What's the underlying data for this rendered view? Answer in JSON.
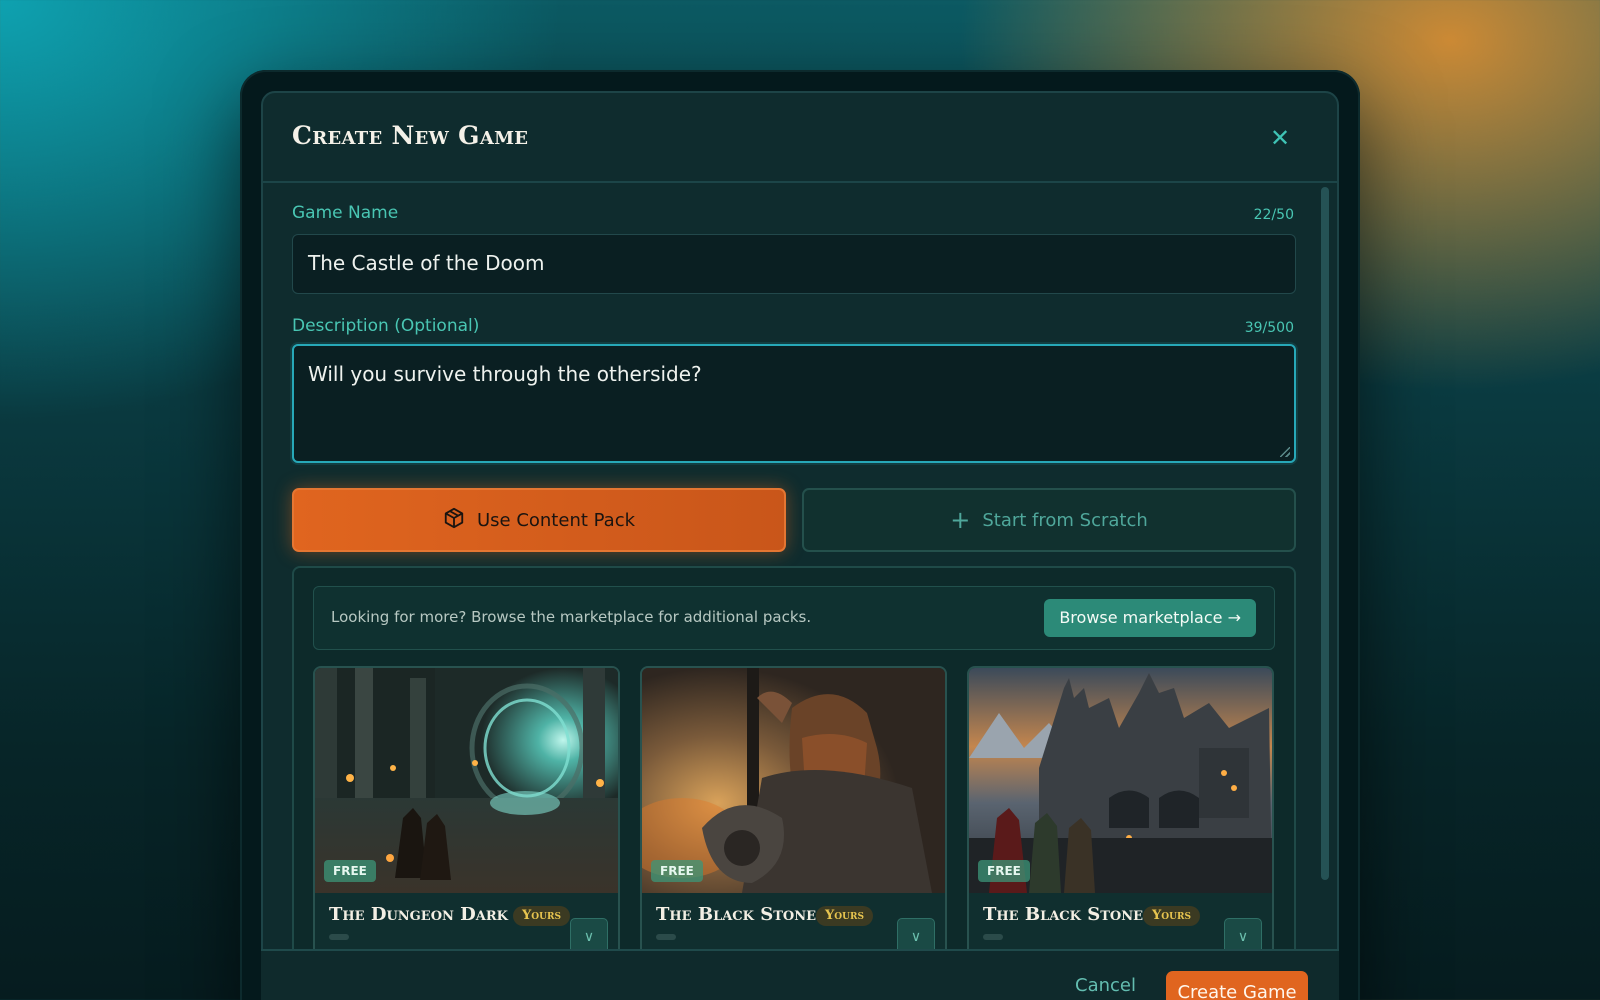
{
  "dialog": {
    "title": "Create New Game",
    "close_icon": "close-icon"
  },
  "game_name": {
    "label": "Game Name",
    "counter": "22/50",
    "value": "The Castle of the Doom"
  },
  "description": {
    "label": "Description (Optional)",
    "counter": "39/500",
    "value": "Will you survive through the otherside?"
  },
  "modes": {
    "content_pack": {
      "label": "Use Content Pack",
      "icon": "package-icon",
      "selected": true
    },
    "scratch": {
      "label": "Start from Scratch",
      "icon": "plus-icon",
      "selected": false
    }
  },
  "marketplace": {
    "text": "Looking for more? Browse the marketplace for additional packs.",
    "button_label": "Browse marketplace →"
  },
  "packs": [
    {
      "title": "The Dungeon Dark",
      "badge": "FREE",
      "owner_badge": "Yours"
    },
    {
      "title": "The Black Stone",
      "badge": "FREE",
      "owner_badge": "Yours"
    },
    {
      "title": "The Black Stone",
      "badge": "FREE",
      "owner_badge": "Yours"
    }
  ],
  "footer": {
    "cancel_label": "Cancel",
    "create_label": "Create Game"
  },
  "colors": {
    "accent_orange": "#e0651f",
    "accent_teal": "#49c6b3",
    "focus_border": "#27a8b8",
    "dialog_bg": "#0f2c2e"
  }
}
